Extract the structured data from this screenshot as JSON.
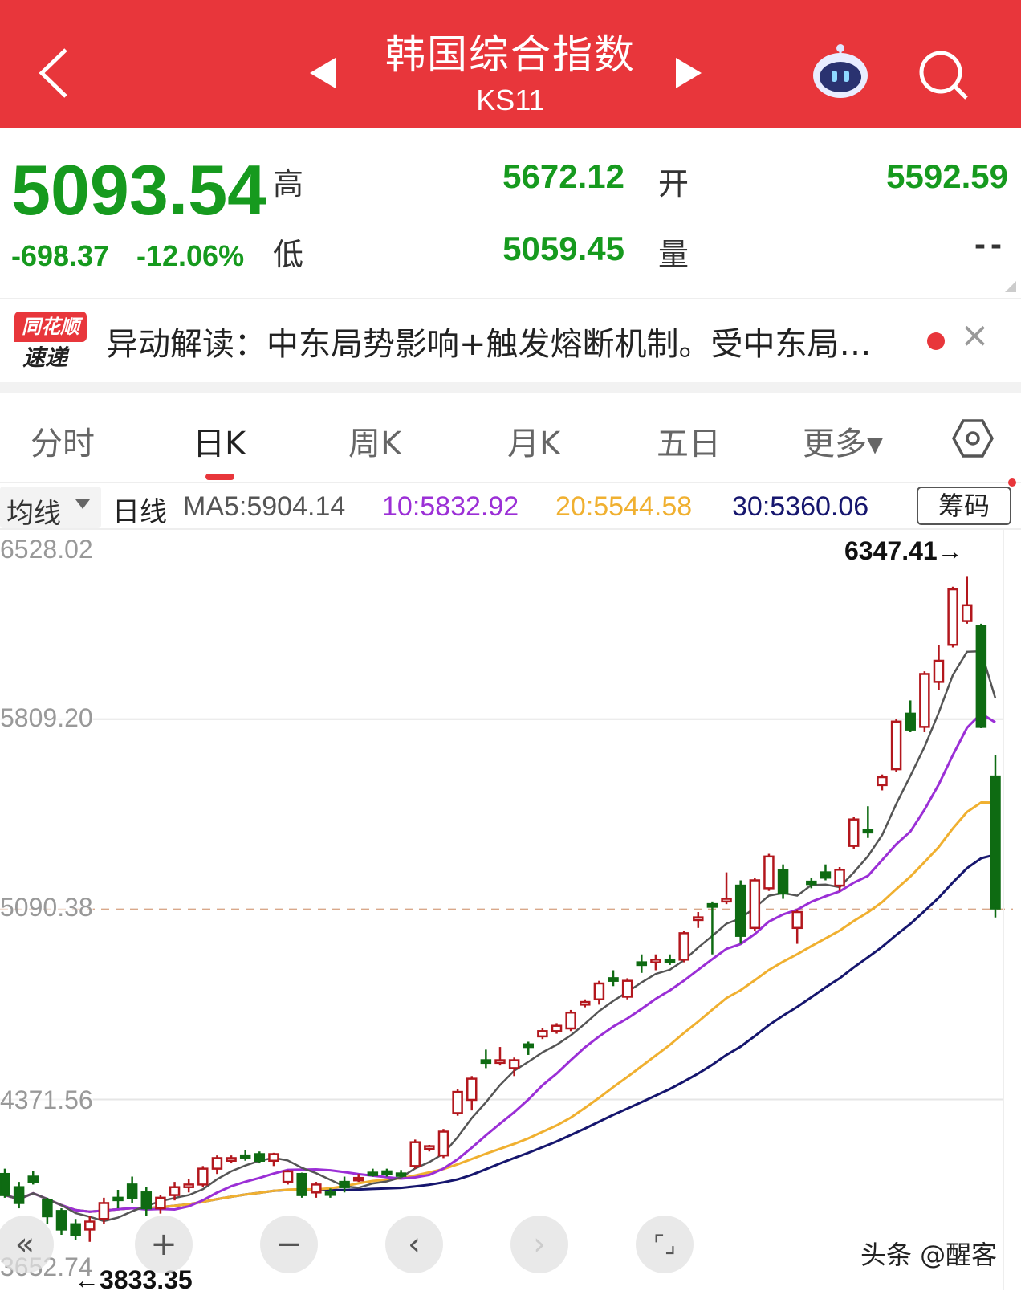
{
  "header": {
    "title": "韩国综合指数",
    "code": "KS11",
    "back_icon": "chevron-left-icon",
    "prev_icon": "triangle-left-icon",
    "next_icon": "triangle-right-icon",
    "robot_icon": "robot-icon",
    "search_icon": "search-icon"
  },
  "quote": {
    "price": "5093.54",
    "change": "-698.37",
    "change_pct": "-12.06%",
    "high_label": "高",
    "high": "5672.12",
    "open_label": "开",
    "open": "5592.59",
    "low_label": "低",
    "low": "5059.45",
    "volume_label": "量",
    "volume": "--",
    "color_down": "#169a1e"
  },
  "news": {
    "logo_top": "同花顺",
    "logo_bottom": "速递",
    "text": "异动解读：中东局势影响+触发熔断机制。受中东局…",
    "close": "×"
  },
  "tabs": [
    {
      "label": "分时"
    },
    {
      "label": "日K",
      "active": true
    },
    {
      "label": "周K"
    },
    {
      "label": "月K"
    },
    {
      "label": "五日"
    },
    {
      "label": "更多▾"
    }
  ],
  "ma_bar": {
    "selector": "均线",
    "period": "日线",
    "ma5": "MA5:5904.14",
    "ma10": "10:5832.92",
    "ma20": "20:5544.58",
    "ma30": "30:5360.06",
    "chips": "筹码"
  },
  "chart_data": {
    "type": "candlestick",
    "y_ticks": [
      "6528.02",
      "5809.20",
      "5090.38",
      "4371.56",
      "3652.74"
    ],
    "ylim": [
      3652.74,
      6528.02
    ],
    "reference_line": 5090.38,
    "max_annotation": "6347.41→",
    "min_annotation": "←3833.35",
    "colors": {
      "up": "#b3171d",
      "down": "#0e6b12",
      "ma5": "#555555",
      "ma10": "#9b2fd6",
      "ma20": "#f0b030",
      "ma30": "#16166e"
    },
    "candles_ohlc": [
      [
        4090,
        4110,
        4000,
        4010
      ],
      [
        4040,
        4060,
        3960,
        3980
      ],
      [
        4080,
        4100,
        4050,
        4060
      ],
      [
        3990,
        4000,
        3900,
        3930
      ],
      [
        3950,
        3960,
        3860,
        3880
      ],
      [
        3900,
        3920,
        3840,
        3860
      ],
      [
        3880,
        3930,
        3833.35,
        3910
      ],
      [
        3920,
        4000,
        3900,
        3980
      ],
      [
        4000,
        4030,
        3960,
        3995
      ],
      [
        4050,
        4080,
        3980,
        4000
      ],
      [
        4020,
        4040,
        3930,
        3960
      ],
      [
        3960,
        4010,
        3940,
        4000
      ],
      [
        4010,
        4060,
        3990,
        4040
      ],
      [
        4040,
        4070,
        4020,
        4050
      ],
      [
        4050,
        4120,
        4040,
        4110
      ],
      [
        4110,
        4160,
        4090,
        4150
      ],
      [
        4140,
        4160,
        4130,
        4150
      ],
      [
        4160,
        4180,
        4140,
        4150
      ],
      [
        4165,
        4175,
        4130,
        4140
      ],
      [
        4140,
        4170,
        4120,
        4165
      ],
      [
        4060,
        4105,
        4050,
        4100
      ],
      [
        4090,
        4095,
        4000,
        4010
      ],
      [
        4020,
        4060,
        4000,
        4050
      ],
      [
        4020,
        4035,
        4000,
        4015
      ],
      [
        4060,
        4080,
        4020,
        4040
      ],
      [
        4070,
        4090,
        4060,
        4075
      ],
      [
        4095,
        4110,
        4080,
        4090
      ],
      [
        4100,
        4110,
        4080,
        4090
      ],
      [
        4092,
        4105,
        4080,
        4090
      ],
      [
        4120,
        4220,
        4110,
        4210
      ],
      [
        4185,
        4200,
        4175,
        4195
      ],
      [
        4160,
        4260,
        4150,
        4250
      ],
      [
        4320,
        4410,
        4310,
        4400
      ],
      [
        4370,
        4460,
        4330,
        4450
      ],
      [
        4520,
        4560,
        4490,
        4510
      ],
      [
        4510,
        4570,
        4500,
        4520
      ],
      [
        4490,
        4530,
        4460,
        4520
      ],
      [
        4580,
        4590,
        4540,
        4570
      ],
      [
        4610,
        4640,
        4600,
        4630
      ],
      [
        4630,
        4660,
        4620,
        4650
      ],
      [
        4640,
        4710,
        4630,
        4700
      ],
      [
        4730,
        4750,
        4720,
        4740
      ],
      [
        4750,
        4820,
        4730,
        4810
      ],
      [
        4830,
        4860,
        4800,
        4820
      ],
      [
        4760,
        4830,
        4750,
        4820
      ],
      [
        4890,
        4920,
        4850,
        4880
      ],
      [
        4890,
        4920,
        4860,
        4900
      ],
      [
        4900,
        4920,
        4880,
        4890
      ],
      [
        4900,
        5010,
        4890,
        5000
      ],
      [
        5050,
        5080,
        5020,
        5060
      ],
      [
        5110,
        5120,
        4920,
        5100
      ],
      [
        5120,
        5230,
        5110,
        5130
      ],
      [
        5180,
        5200,
        4960,
        4990
      ],
      [
        5020,
        5210,
        5010,
        5200
      ],
      [
        5170,
        5300,
        5160,
        5290
      ],
      [
        5240,
        5260,
        5130,
        5150
      ],
      [
        5020,
        5090,
        4960,
        5080
      ],
      [
        5195,
        5210,
        5170,
        5190
      ],
      [
        5230,
        5260,
        5200,
        5210
      ],
      [
        5180,
        5250,
        5160,
        5240
      ],
      [
        5330,
        5440,
        5320,
        5430
      ],
      [
        5390,
        5480,
        5360,
        5385
      ],
      [
        5560,
        5600,
        5540,
        5590
      ],
      [
        5620,
        5810,
        5610,
        5800
      ],
      [
        5830,
        5880,
        5760,
        5770
      ],
      [
        5780,
        5990,
        5760,
        5980
      ],
      [
        5950,
        6090,
        5920,
        6030
      ],
      [
        6090,
        6310,
        6080,
        6300
      ],
      [
        6180,
        6347.41,
        6170,
        6240
      ],
      [
        6160,
        6170,
        5775,
        5780
      ],
      [
        5592.59,
        5672.12,
        5059.45,
        5093.54
      ]
    ]
  },
  "controls": {
    "first": "«",
    "zoom_in": "+",
    "zoom_out": "−",
    "prev": "‹",
    "next": "›",
    "fullscreen": "⌜⌟"
  },
  "watermark": "头条 @醒客"
}
